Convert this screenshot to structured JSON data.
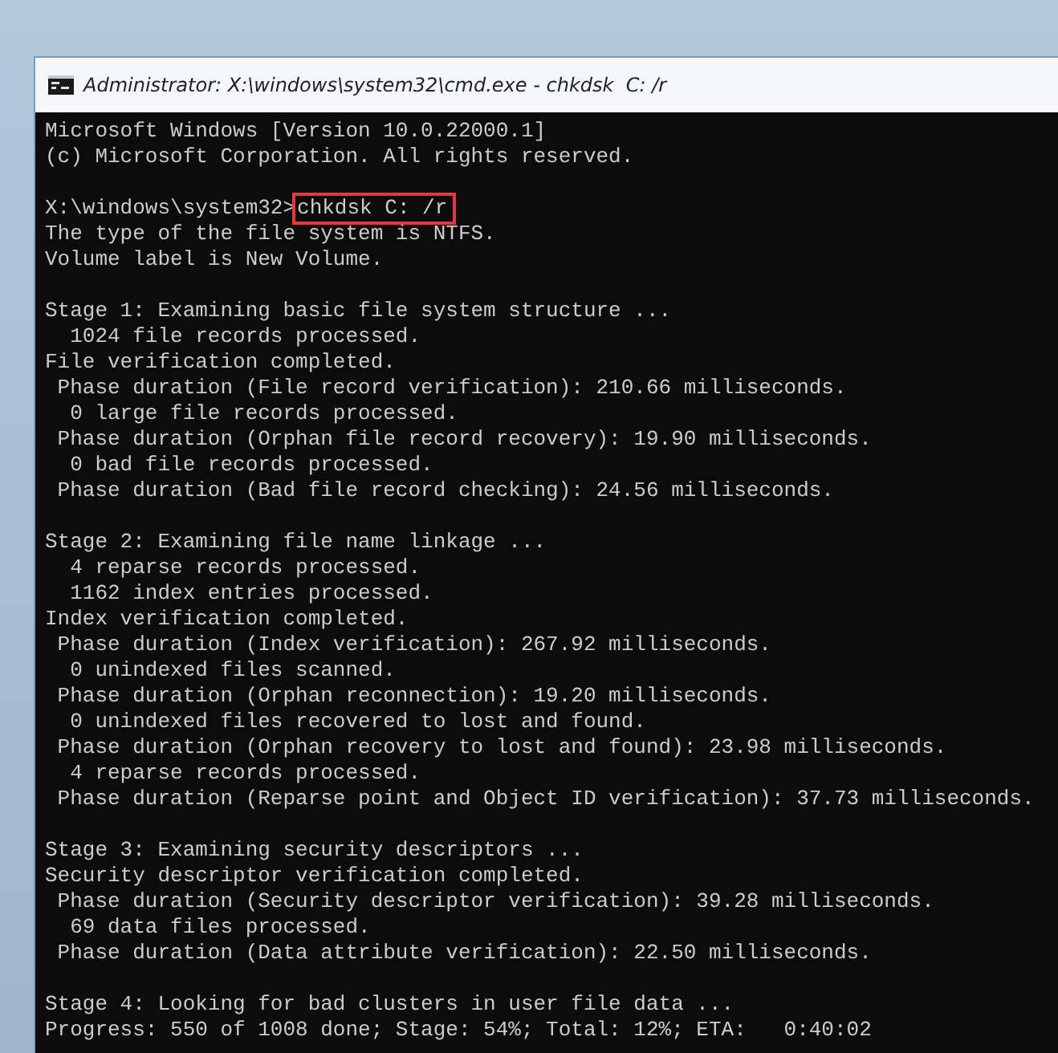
{
  "window": {
    "title": "Administrator: X:\\windows\\system32\\cmd.exe - chkdsk  C: /r"
  },
  "console": {
    "lines": [
      {
        "kind": "output",
        "text": "Microsoft Windows [Version 10.0.22000.1]"
      },
      {
        "kind": "output",
        "text": "(c) Microsoft Corporation. All rights reserved."
      },
      {
        "kind": "blank"
      },
      {
        "kind": "command",
        "prompt": "X:\\windows\\system32>",
        "text": "chkdsk C: /r",
        "highlighted": true
      },
      {
        "kind": "output",
        "text": "The type of the file system is NTFS."
      },
      {
        "kind": "output",
        "text": "Volume label is New Volume."
      },
      {
        "kind": "blank"
      },
      {
        "kind": "output",
        "text": "Stage 1: Examining basic file system structure ..."
      },
      {
        "kind": "output",
        "text": "  1024 file records processed."
      },
      {
        "kind": "output",
        "text": "File verification completed."
      },
      {
        "kind": "output",
        "text": " Phase duration (File record verification): 210.66 milliseconds."
      },
      {
        "kind": "output",
        "text": "  0 large file records processed."
      },
      {
        "kind": "output",
        "text": " Phase duration (Orphan file record recovery): 19.90 milliseconds."
      },
      {
        "kind": "output",
        "text": "  0 bad file records processed."
      },
      {
        "kind": "output",
        "text": " Phase duration (Bad file record checking): 24.56 milliseconds."
      },
      {
        "kind": "blank"
      },
      {
        "kind": "output",
        "text": "Stage 2: Examining file name linkage ..."
      },
      {
        "kind": "output",
        "text": "  4 reparse records processed."
      },
      {
        "kind": "output",
        "text": "  1162 index entries processed."
      },
      {
        "kind": "output",
        "text": "Index verification completed."
      },
      {
        "kind": "output",
        "text": " Phase duration (Index verification): 267.92 milliseconds."
      },
      {
        "kind": "output",
        "text": "  0 unindexed files scanned."
      },
      {
        "kind": "output",
        "text": " Phase duration (Orphan reconnection): 19.20 milliseconds."
      },
      {
        "kind": "output",
        "text": "  0 unindexed files recovered to lost and found."
      },
      {
        "kind": "output",
        "text": " Phase duration (Orphan recovery to lost and found): 23.98 milliseconds."
      },
      {
        "kind": "output",
        "text": "  4 reparse records processed."
      },
      {
        "kind": "output",
        "text": " Phase duration (Reparse point and Object ID verification): 37.73 milliseconds."
      },
      {
        "kind": "blank"
      },
      {
        "kind": "output",
        "text": "Stage 3: Examining security descriptors ..."
      },
      {
        "kind": "output",
        "text": "Security descriptor verification completed."
      },
      {
        "kind": "output",
        "text": " Phase duration (Security descriptor verification): 39.28 milliseconds."
      },
      {
        "kind": "output",
        "text": "  69 data files processed."
      },
      {
        "kind": "output",
        "text": " Phase duration (Data attribute verification): 22.50 milliseconds."
      },
      {
        "kind": "blank"
      },
      {
        "kind": "output",
        "text": "Stage 4: Looking for bad clusters in user file data ..."
      },
      {
        "kind": "output",
        "text": "Progress: 550 of 1008 done; Stage: 54%; Total: 12%; ETA:   0:40:02"
      }
    ]
  }
}
